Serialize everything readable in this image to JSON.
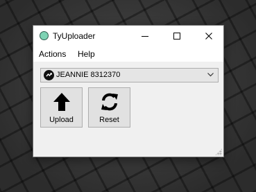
{
  "window": {
    "title": "TyUploader",
    "app_icon": "circle-app-icon",
    "app_icon_color": "#7ed3b4",
    "controls": [
      "minimize-icon",
      "maximize-icon",
      "close-icon"
    ]
  },
  "menu": {
    "items": [
      {
        "label": "Actions"
      },
      {
        "label": "Help"
      }
    ]
  },
  "device_select": {
    "selected": "JEANNIE 8312370",
    "icon": "teensy-device-icon",
    "arrow_icon": "chevron-down-icon"
  },
  "toolbar": {
    "upload": {
      "label": "Upload",
      "icon": "arrow-up-icon"
    },
    "reset": {
      "label": "Reset",
      "icon": "refresh-icon"
    }
  }
}
